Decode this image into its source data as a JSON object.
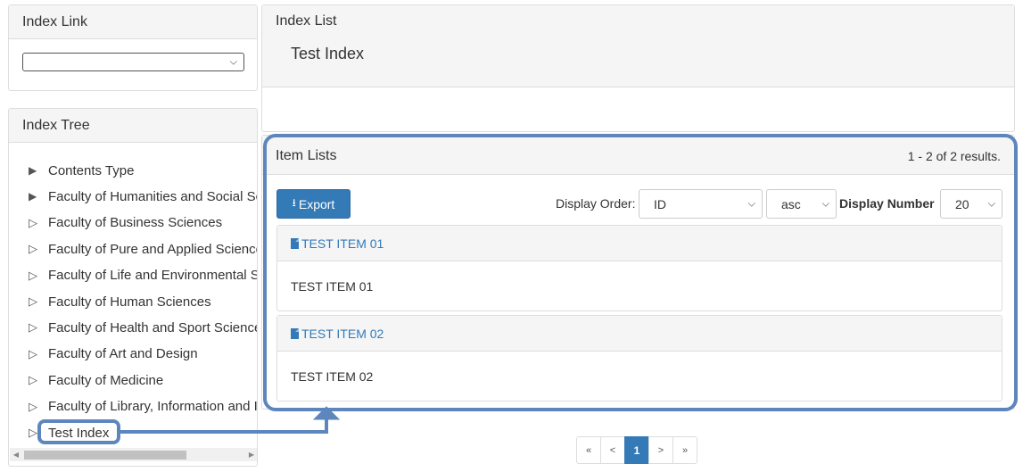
{
  "index_link": {
    "heading": "Index Link",
    "select_value": ""
  },
  "index_tree": {
    "heading": "Index Tree",
    "items": [
      {
        "label": "Contents Type",
        "arrow": "▶"
      },
      {
        "label": "Faculty of Humanities and Social Sc",
        "arrow": "▶"
      },
      {
        "label": "Faculty of Business Sciences",
        "arrow": "▷"
      },
      {
        "label": "Faculty of Pure and Applied Science",
        "arrow": "▷"
      },
      {
        "label": "Faculty of Life and Environmental S",
        "arrow": "▷"
      },
      {
        "label": "Faculty of Human Sciences",
        "arrow": "▷"
      },
      {
        "label": "Faculty of Health and Sport Science",
        "arrow": "▷"
      },
      {
        "label": "Faculty of Art and Design",
        "arrow": "▷"
      },
      {
        "label": "Faculty of Medicine",
        "arrow": "▷"
      },
      {
        "label": "Faculty of Library, Information and I",
        "arrow": "▷"
      },
      {
        "label": "Test Index",
        "arrow": "▷"
      }
    ]
  },
  "index_list": {
    "heading": "Index List",
    "index_name": "Test Index"
  },
  "item_lists": {
    "heading": "Item Lists",
    "results": "1 - 2 of 2 results.",
    "export_label": "Export",
    "display_order_label": "Display Order:",
    "order_value": "ID",
    "direction_value": "asc",
    "display_number_label": "Display Number",
    "number_value": "20",
    "items": [
      {
        "title": "TEST ITEM 01",
        "body": "TEST ITEM 01"
      },
      {
        "title": "TEST ITEM 02",
        "body": "TEST ITEM 02"
      }
    ]
  },
  "pagination": {
    "first": "«",
    "prev": "<",
    "current": "1",
    "next": ">",
    "last": "»"
  },
  "colors": {
    "primary": "#337ab7",
    "highlight": "#5d86bd"
  }
}
